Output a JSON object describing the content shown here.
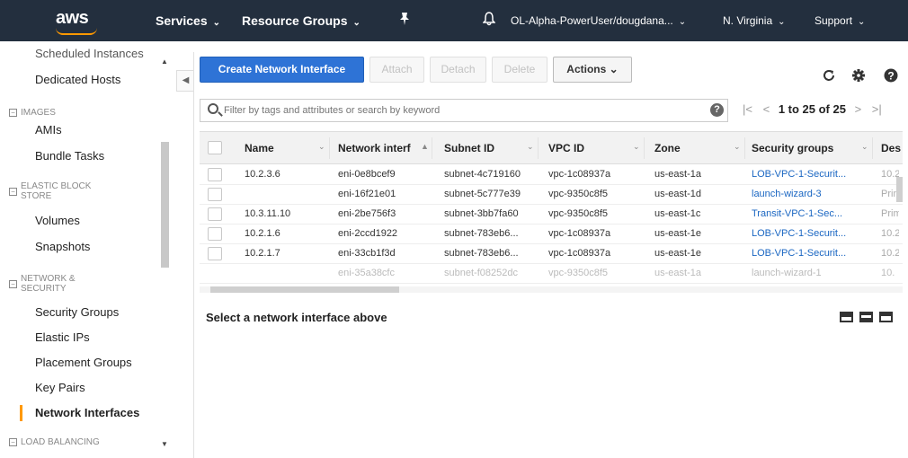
{
  "nav": {
    "logo": "aws",
    "services": "Services",
    "resource_groups": "Resource Groups",
    "account": "OL-Alpha-PowerUser/dougdana...",
    "region": "N. Virginia",
    "support": "Support",
    "caret": "⌄",
    "pin_icon": "pin-icon",
    "bell_icon": "bell-icon"
  },
  "sidebar": {
    "cut_item": "Scheduled Instances",
    "dedicated_hosts": "Dedicated Hosts",
    "images_section": "IMAGES",
    "amis": "AMIs",
    "bundle_tasks": "Bundle Tasks",
    "ebs_section_1": "ELASTIC BLOCK",
    "ebs_section_2": "STORE",
    "volumes": "Volumes",
    "snapshots": "Snapshots",
    "net_section_1": "NETWORK &",
    "net_section_2": "SECURITY",
    "security_groups": "Security Groups",
    "elastic_ips": "Elastic IPs",
    "placement_groups": "Placement Groups",
    "key_pairs": "Key Pairs",
    "network_interfaces": "Network Interfaces",
    "lb_section": "LOAD BALANCING",
    "collapse_box": "−"
  },
  "toolbar": {
    "create": "Create Network Interface",
    "attach": "Attach",
    "detach": "Detach",
    "delete": "Delete",
    "actions": "Actions",
    "actions_caret": "⌄"
  },
  "search": {
    "placeholder": "Filter by tags and attributes or search by keyword",
    "help": "?"
  },
  "pager": {
    "first": "|<",
    "prev": "<",
    "range": "1 to 25 of 25",
    "next": ">",
    "last": ">|"
  },
  "table": {
    "headers": [
      "Name",
      "Network interf",
      "Subnet ID",
      "VPC ID",
      "Zone",
      "Security groups",
      "Des"
    ],
    "rows": [
      [
        "10.2.3.6",
        "eni-0e8bcef9",
        "subnet-4c719160",
        "vpc-1c08937a",
        "us-east-1a",
        "LOB-VPC-1-Securit...",
        "10.2"
      ],
      [
        "",
        "eni-16f21e01",
        "subnet-5c777e39",
        "vpc-9350c8f5",
        "us-east-1d",
        "launch-wizard-3",
        "Prim"
      ],
      [
        "10.3.11.10",
        "eni-2be756f3",
        "subnet-3bb7fa60",
        "vpc-9350c8f5",
        "us-east-1c",
        "Transit-VPC-1-Sec...",
        "Prim"
      ],
      [
        "10.2.1.6",
        "eni-2ccd1922",
        "subnet-783eb6...",
        "vpc-1c08937a",
        "us-east-1e",
        "LOB-VPC-1-Securit...",
        "10.2"
      ],
      [
        "10.2.1.7",
        "eni-33cb1f3d",
        "subnet-783eb6...",
        "vpc-1c08937a",
        "us-east-1e",
        "LOB-VPC-1-Securit...",
        "10.2"
      ],
      [
        "",
        "eni-35a38cfc",
        "subnet-f08252dc",
        "vpc-9350c8f5",
        "us-east-1a",
        "launch-wizard-1",
        "10."
      ]
    ]
  },
  "details": {
    "label": "Select a network interface above"
  },
  "colors": {
    "nav_bg": "#232f3e",
    "primary_button": "#2e73d6",
    "active_marker": "#ff9900",
    "link": "#1a66c2"
  }
}
